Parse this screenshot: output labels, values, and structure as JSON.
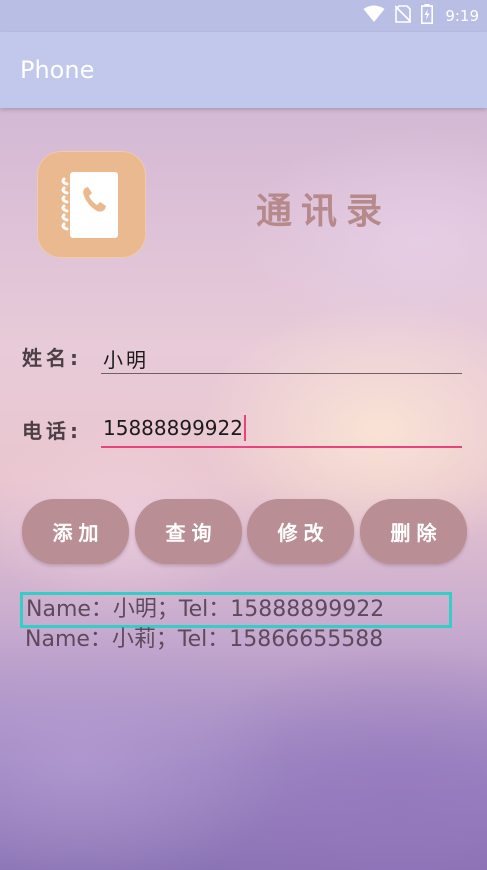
{
  "status_bar": {
    "time": "9:19",
    "icons": [
      "wifi-icon",
      "no-sim-icon",
      "battery-charging-icon"
    ]
  },
  "app_bar": {
    "title": "Phone"
  },
  "header": {
    "logo_icon": "contact-book-phone-icon",
    "title": "通讯录"
  },
  "form": {
    "name_label": "姓名:",
    "name_value": "小明",
    "tel_label": "电话:",
    "tel_value": "15888899922"
  },
  "buttons": {
    "add": "添加",
    "query": "查询",
    "edit": "修改",
    "delete": "删除"
  },
  "results": [
    {
      "text": "Name：小明；Tel：15888899922",
      "selected": true
    },
    {
      "text": "Name：小莉；Tel：15866655588",
      "selected": false
    }
  ],
  "colors": {
    "status_bar": "#b9bfe4",
    "app_bar": "#c2c8ec",
    "button": "#b98e95",
    "accent": "#e8437c",
    "selection": "#33cfc6",
    "logo": "#eab98f"
  }
}
